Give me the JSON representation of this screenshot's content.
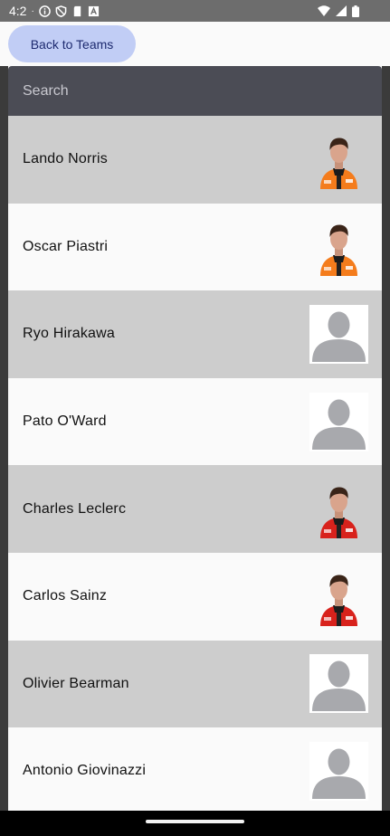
{
  "status_bar": {
    "time": "4:2",
    "left_icons": [
      "info-icon",
      "shield-icon",
      "sd-card-icon",
      "text-icon"
    ],
    "right_icons": [
      "wifi-icon",
      "cellular-icon",
      "battery-icon"
    ]
  },
  "top_bar": {
    "back_label": "Back to Teams"
  },
  "search": {
    "placeholder": "Search",
    "value": ""
  },
  "drivers": [
    {
      "name": "Lando Norris",
      "photo": "driver-photo-orange-suit",
      "suit_color": "#f47c1c"
    },
    {
      "name": "Oscar Piastri",
      "photo": "driver-photo-orange-suit",
      "suit_color": "#f47c1c"
    },
    {
      "name": "Ryo Hirakawa",
      "photo": "placeholder-avatar",
      "suit_color": ""
    },
    {
      "name": "Pato O'Ward",
      "photo": "placeholder-avatar",
      "suit_color": ""
    },
    {
      "name": "Charles Leclerc",
      "photo": "driver-photo-red-suit",
      "suit_color": "#d8221c"
    },
    {
      "name": "Carlos Sainz",
      "photo": "driver-photo-red-suit",
      "suit_color": "#d8221c"
    },
    {
      "name": "Olivier Bearman",
      "photo": "placeholder-avatar",
      "suit_color": ""
    },
    {
      "name": "Antonio Giovinazzi",
      "photo": "placeholder-avatar",
      "suit_color": ""
    }
  ],
  "colors": {
    "row_shaded": "#cdcdcd",
    "row_plain": "#fafafa",
    "search_bg": "#4b4c55",
    "button_bg": "#c1cdf5",
    "button_text": "#1d2a6f"
  }
}
